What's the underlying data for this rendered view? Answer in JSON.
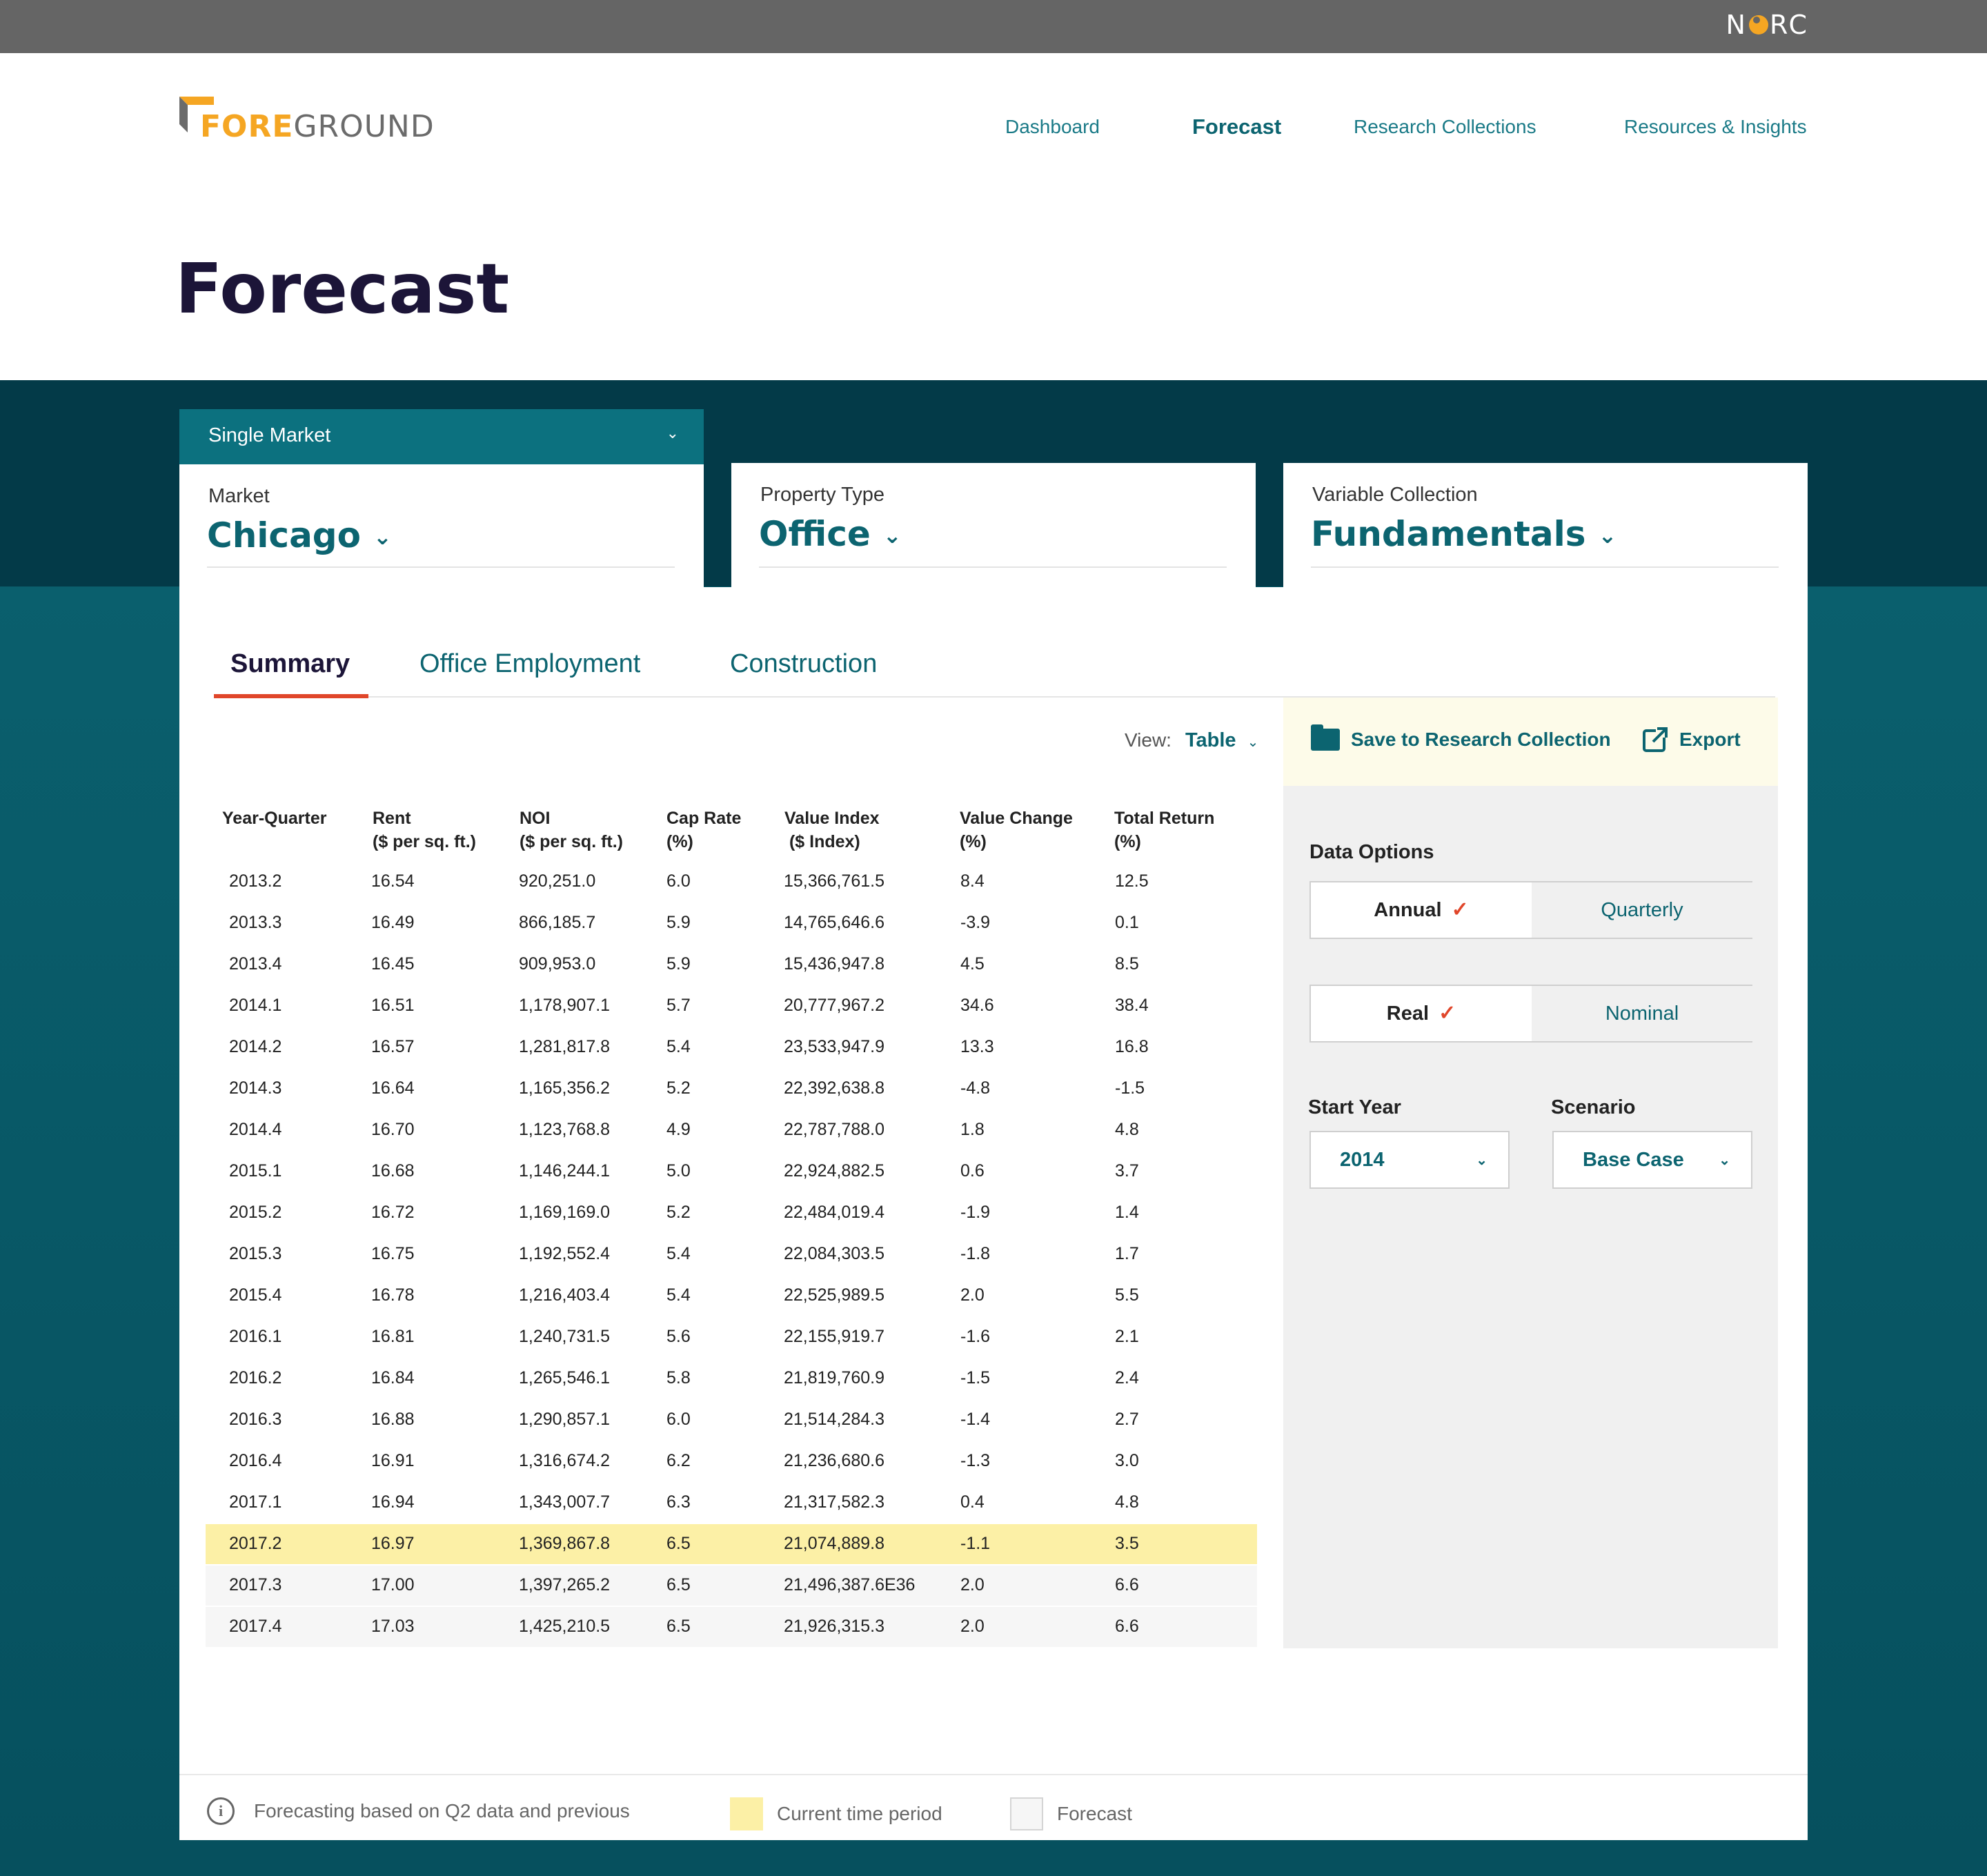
{
  "brand": {
    "org": "NORC",
    "logo_fore": "FORE",
    "logo_ground": "GROUND"
  },
  "nav": {
    "dashboard": "Dashboard",
    "forecast": "Forecast",
    "research": "Research Collections",
    "resources": "Resources & Insights"
  },
  "page_title": "Forecast",
  "mode_select": "Single Market",
  "selectors": {
    "market": {
      "label": "Market",
      "value": "Chicago"
    },
    "property": {
      "label": "Property Type",
      "value": "Office"
    },
    "variables": {
      "label": "Variable Collection",
      "value": "Fundamentals"
    }
  },
  "tabs": [
    "Summary",
    "Office Employment",
    "Construction"
  ],
  "view": {
    "label": "View:",
    "value": "Table"
  },
  "actions": {
    "save": "Save to Research Collection",
    "export": "Export"
  },
  "table": {
    "headers": [
      [
        "Year-Quarter",
        ""
      ],
      [
        "Rent",
        "($ per sq. ft.)"
      ],
      [
        "NOI",
        "($ per sq. ft.)"
      ],
      [
        "Cap Rate",
        "(%)"
      ],
      [
        "Value Index",
        " ($ Index)"
      ],
      [
        "Value Change",
        "(%)"
      ],
      [
        "Total Return",
        "(%)"
      ]
    ],
    "rows": [
      [
        "2013.2",
        "16.54",
        "920,251.0",
        "6.0",
        "15,366,761.5",
        "8.4",
        "12.5"
      ],
      [
        "2013.3",
        "16.49",
        "866,185.7",
        "5.9",
        "14,765,646.6",
        "-3.9",
        "0.1"
      ],
      [
        "2013.4",
        "16.45",
        "909,953.0",
        "5.9",
        "15,436,947.8",
        "4.5",
        "8.5"
      ],
      [
        "2014.1",
        "16.51",
        "1,178,907.1",
        "5.7",
        "20,777,967.2",
        "34.6",
        "38.4"
      ],
      [
        "2014.2",
        "16.57",
        "1,281,817.8",
        "5.4",
        "23,533,947.9",
        "13.3",
        "16.8"
      ],
      [
        "2014.3",
        "16.64",
        "1,165,356.2",
        "5.2",
        "22,392,638.8",
        "-4.8",
        "-1.5"
      ],
      [
        "2014.4",
        "16.70",
        "1,123,768.8",
        "4.9",
        "22,787,788.0",
        "1.8",
        "4.8"
      ],
      [
        "2015.1",
        "16.68",
        "1,146,244.1",
        "5.0",
        "22,924,882.5",
        "0.6",
        "3.7"
      ],
      [
        "2015.2",
        "16.72",
        "1,169,169.0",
        "5.2",
        "22,484,019.4",
        "-1.9",
        "1.4"
      ],
      [
        "2015.3",
        "16.75",
        "1,192,552.4",
        "5.4",
        "22,084,303.5",
        "-1.8",
        "1.7"
      ],
      [
        "2015.4",
        "16.78",
        "1,216,403.4",
        "5.4",
        "22,525,989.5",
        "2.0",
        "5.5"
      ],
      [
        "2016.1",
        "16.81",
        "1,240,731.5",
        "5.6",
        "22,155,919.7",
        "-1.6",
        "2.1"
      ],
      [
        "2016.2",
        "16.84",
        "1,265,546.1",
        "5.8",
        "21,819,760.9",
        "-1.5",
        "2.4"
      ],
      [
        "2016.3",
        "16.88",
        "1,290,857.1",
        "6.0",
        "21,514,284.3",
        "-1.4",
        "2.7"
      ],
      [
        "2016.4",
        "16.91",
        "1,316,674.2",
        "6.2",
        "21,236,680.6",
        "-1.3",
        "3.0"
      ],
      [
        "2017.1",
        "16.94",
        "1,343,007.7",
        "6.3",
        "21,317,582.3",
        "0.4",
        "4.8"
      ],
      [
        "2017.2",
        "16.97",
        "1,369,867.8",
        "6.5",
        "21,074,889.8",
        "-1.1",
        "3.5"
      ],
      [
        "2017.3",
        "17.00",
        "1,397,265.2",
        "6.5",
        "21,496,387.6E36",
        "2.0",
        "6.6"
      ],
      [
        "2017.4",
        "17.03",
        "1,425,210.5",
        "6.5",
        "21,926,315.3",
        "2.0",
        "6.6"
      ]
    ],
    "current_row": 16,
    "forecast_from_row": 17
  },
  "data_options": {
    "title": "Data Options",
    "freq": {
      "on": "Annual",
      "off": "Quarterly"
    },
    "basis": {
      "on": "Real",
      "off": "Nominal"
    },
    "start_year": {
      "label": "Start Year",
      "value": "2014"
    },
    "scenario": {
      "label": "Scenario",
      "value": "Base Case"
    }
  },
  "legend": {
    "note": "Forecasting based on Q2 data and previous",
    "current": "Current time period",
    "forecast": "Forecast"
  },
  "colors": {
    "teal": "#0c6470",
    "accent": "#e0462a",
    "current_row": "#fcf0a6",
    "brand_orange": "#f5a623"
  }
}
